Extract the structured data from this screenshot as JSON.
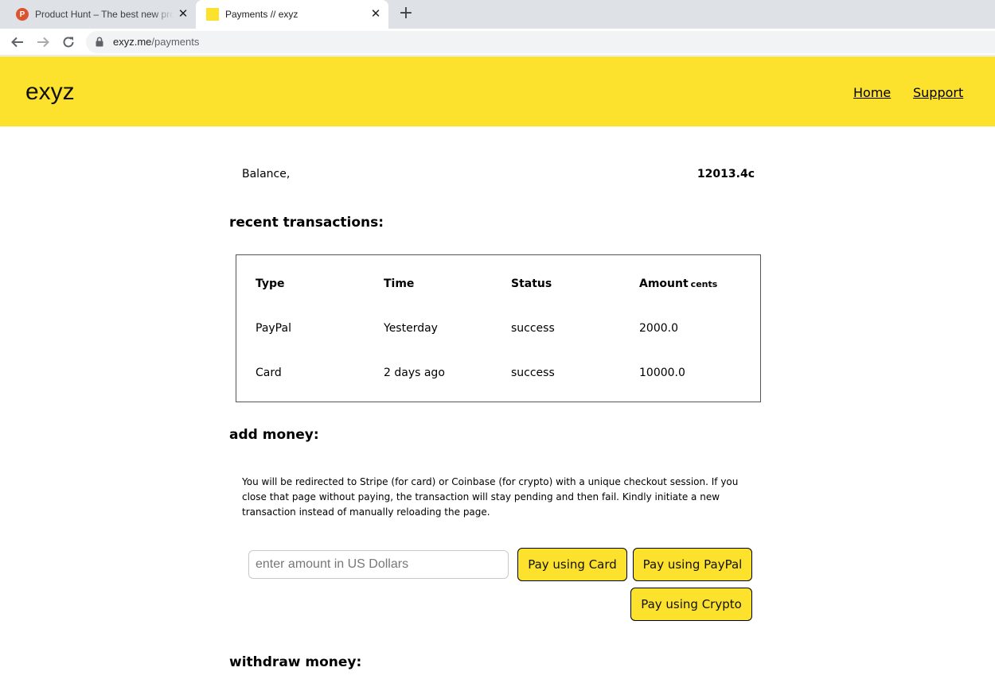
{
  "browser": {
    "tabs": [
      {
        "title": "Product Hunt – The best new products in tech",
        "favicon": "P",
        "favicon_color": "#da552f"
      },
      {
        "title": "Payments // exyz",
        "favicon_color": "#fde22d",
        "active": true
      }
    ],
    "new_tab_label": "+",
    "close_label": "✕",
    "url_host": "exyz.me",
    "url_path": "/payments"
  },
  "header": {
    "logo": "exyz",
    "background": "#fde22d",
    "nav": [
      {
        "label": "Home"
      },
      {
        "label": "Support"
      }
    ]
  },
  "balance": {
    "label": "Balance,",
    "value": "12013.4c"
  },
  "transactions": {
    "title": "recent transactions:",
    "columns": [
      "Type",
      "Time",
      "Status",
      "Amount"
    ],
    "amount_unit": "cents",
    "rows": [
      [
        "PayPal",
        "Yesterday",
        "success",
        "2000.0"
      ],
      [
        "Card",
        "2 days ago",
        "success",
        "10000.0"
      ]
    ]
  },
  "add_money": {
    "title": "add money:",
    "info": "You will be redirected to Stripe (for card) or Coinbase (for crypto) with a unique checkout session. If you close that page without paying, the transaction will stay pending and then fail. Kindly initiate a new transaction instead of manually reloading the page.",
    "amount_placeholder": "enter amount in US Dollars",
    "buttons": {
      "card": "Pay using Card",
      "paypal": "Pay using PayPal",
      "crypto": "Pay using Crypto"
    }
  },
  "withdraw_money": {
    "title": "withdraw money:"
  }
}
